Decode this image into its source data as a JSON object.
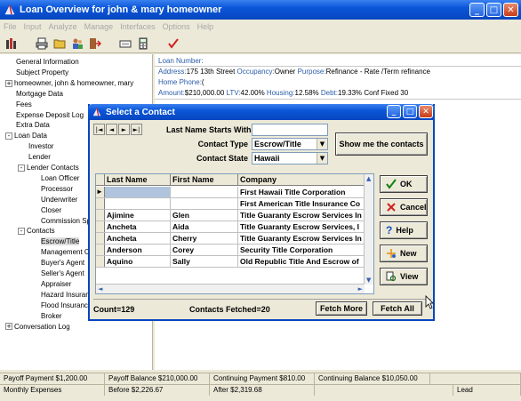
{
  "window": {
    "title": "Loan Overview for john & mary homeowner"
  },
  "menu": [
    "File",
    "Input",
    "Analyze",
    "Manage",
    "Interfaces",
    "Options",
    "Help"
  ],
  "tree": [
    {
      "label": "General Information",
      "indent": 0,
      "exp": ""
    },
    {
      "label": "Subject Property",
      "indent": 0,
      "exp": ""
    },
    {
      "label": "homeowner, john & homeowner, mary",
      "indent": 0,
      "exp": "+"
    },
    {
      "label": "Mortgage Data",
      "indent": 0,
      "exp": ""
    },
    {
      "label": "Fees",
      "indent": 0,
      "exp": ""
    },
    {
      "label": "Expense Deposit Log",
      "indent": 0,
      "exp": ""
    },
    {
      "label": "Extra Data",
      "indent": 0,
      "exp": ""
    },
    {
      "label": "Loan Data",
      "indent": 0,
      "exp": "-"
    },
    {
      "label": "Investor",
      "indent": 1,
      "exp": ""
    },
    {
      "label": "Lender",
      "indent": 1,
      "exp": ""
    },
    {
      "label": "Lender Contacts",
      "indent": 1,
      "exp": "-"
    },
    {
      "label": "Loan Officer",
      "indent": 2,
      "exp": ""
    },
    {
      "label": "Processor",
      "indent": 2,
      "exp": ""
    },
    {
      "label": "Underwriter",
      "indent": 2,
      "exp": ""
    },
    {
      "label": "Closer",
      "indent": 2,
      "exp": ""
    },
    {
      "label": "Commission Sp",
      "indent": 2,
      "exp": ""
    },
    {
      "label": "Contacts",
      "indent": 1,
      "exp": "-"
    },
    {
      "label": "Escrow/Title",
      "indent": 2,
      "exp": "",
      "selected": true
    },
    {
      "label": "Management C",
      "indent": 2,
      "exp": ""
    },
    {
      "label": "Buyer's Agent",
      "indent": 2,
      "exp": ""
    },
    {
      "label": "Seller's Agent",
      "indent": 2,
      "exp": ""
    },
    {
      "label": "Appraiser",
      "indent": 2,
      "exp": ""
    },
    {
      "label": "Hazard Insuran",
      "indent": 2,
      "exp": ""
    },
    {
      "label": "Flood Insuranc",
      "indent": 2,
      "exp": ""
    },
    {
      "label": "Broker",
      "indent": 2,
      "exp": ""
    },
    {
      "label": "Conversation Log",
      "indent": 0,
      "exp": "+"
    }
  ],
  "info": {
    "loan_number_label": "Loan Number:",
    "address_label": "Address:",
    "address": "175 13th Street",
    "occupancy_label": "Occupancy:",
    "occupancy": "Owner",
    "purpose_label": "Purpose:",
    "purpose": "Refinance - Rate /Term refinance",
    "home_phone_label": "Home Phone:",
    "home_phone": "(",
    "amount_label": "Amount:",
    "amount": "$210,000.00",
    "ltv_label": "LTV:",
    "ltv": "42.00%",
    "housing_label": "Housing:",
    "housing": "12.58%",
    "debt_label": "Debt:",
    "debt": "19.33%",
    "program": "Conf Fixed 30"
  },
  "status1": [
    "Payoff Payment $1,200.00",
    "Payoff Balance $210,000.00",
    "Continuing Payment $810.00",
    "Continuing Balance $10,050.00",
    ""
  ],
  "status2": [
    "Monthly Expenses",
    "Before $2,226.67",
    "After $2,319.68",
    "",
    "Lead"
  ],
  "dialog": {
    "title": "Select a Contact",
    "nav": [
      "|◄",
      "◄",
      "►",
      "►|"
    ],
    "last_name_label": "Last Name Starts With",
    "last_name_value": "",
    "contact_type_label": "Contact Type",
    "contact_type_value": "Escrow/Title",
    "contact_state_label": "Contact State",
    "contact_state_value": "Hawaii",
    "show_button": "Show me the contacts",
    "columns": [
      "Last Name",
      "First Name",
      "Company"
    ],
    "rows": [
      {
        "marker": "►",
        "last": "",
        "first": "",
        "company": "First Hawaii Title Corporation"
      },
      {
        "marker": "",
        "last": "",
        "first": "",
        "company": "First American Title Insurance Co"
      },
      {
        "marker": "",
        "last": "Ajimine",
        "first": "Glen",
        "company": "Title Guaranty Escrow Services In"
      },
      {
        "marker": "",
        "last": "Ancheta",
        "first": "Aida",
        "company": "Title Guaranty Escrow Services, I"
      },
      {
        "marker": "",
        "last": "Ancheta",
        "first": "Cherry",
        "company": "Title Guaranty Escrow Services In"
      },
      {
        "marker": "",
        "last": "Anderson",
        "first": "Corey",
        "company": "Security Title Corporation"
      },
      {
        "marker": "",
        "last": "Aquino",
        "first": "Sally",
        "company": "Old Republic Title And Escrow of"
      }
    ],
    "buttons": {
      "ok": "OK",
      "cancel": "Cancel",
      "help": "Help",
      "new": "New",
      "view": "View"
    },
    "count": "Count=129",
    "fetched": "Contacts Fetched=20",
    "fetch_more": "Fetch More",
    "fetch_all": "Fetch All"
  },
  "colors": {
    "title_bar": "#0a56d8",
    "info_label": "#2a5ca8",
    "window_bg": "#ece9d8"
  }
}
